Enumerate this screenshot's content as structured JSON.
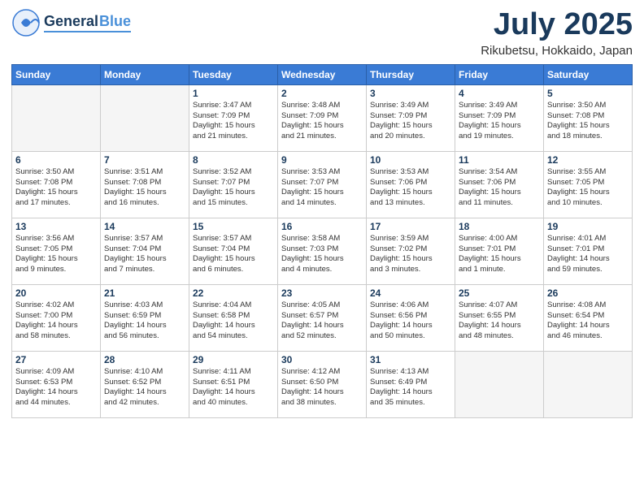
{
  "header": {
    "logo_line1": "General",
    "logo_line2": "Blue",
    "month": "July 2025",
    "location": "Rikubetsu, Hokkaido, Japan"
  },
  "weekdays": [
    "Sunday",
    "Monday",
    "Tuesday",
    "Wednesday",
    "Thursday",
    "Friday",
    "Saturday"
  ],
  "weeks": [
    [
      {
        "day": "",
        "info": ""
      },
      {
        "day": "",
        "info": ""
      },
      {
        "day": "1",
        "info": "Sunrise: 3:47 AM\nSunset: 7:09 PM\nDaylight: 15 hours\nand 21 minutes."
      },
      {
        "day": "2",
        "info": "Sunrise: 3:48 AM\nSunset: 7:09 PM\nDaylight: 15 hours\nand 21 minutes."
      },
      {
        "day": "3",
        "info": "Sunrise: 3:49 AM\nSunset: 7:09 PM\nDaylight: 15 hours\nand 20 minutes."
      },
      {
        "day": "4",
        "info": "Sunrise: 3:49 AM\nSunset: 7:09 PM\nDaylight: 15 hours\nand 19 minutes."
      },
      {
        "day": "5",
        "info": "Sunrise: 3:50 AM\nSunset: 7:08 PM\nDaylight: 15 hours\nand 18 minutes."
      }
    ],
    [
      {
        "day": "6",
        "info": "Sunrise: 3:50 AM\nSunset: 7:08 PM\nDaylight: 15 hours\nand 17 minutes."
      },
      {
        "day": "7",
        "info": "Sunrise: 3:51 AM\nSunset: 7:08 PM\nDaylight: 15 hours\nand 16 minutes."
      },
      {
        "day": "8",
        "info": "Sunrise: 3:52 AM\nSunset: 7:07 PM\nDaylight: 15 hours\nand 15 minutes."
      },
      {
        "day": "9",
        "info": "Sunrise: 3:53 AM\nSunset: 7:07 PM\nDaylight: 15 hours\nand 14 minutes."
      },
      {
        "day": "10",
        "info": "Sunrise: 3:53 AM\nSunset: 7:06 PM\nDaylight: 15 hours\nand 13 minutes."
      },
      {
        "day": "11",
        "info": "Sunrise: 3:54 AM\nSunset: 7:06 PM\nDaylight: 15 hours\nand 11 minutes."
      },
      {
        "day": "12",
        "info": "Sunrise: 3:55 AM\nSunset: 7:05 PM\nDaylight: 15 hours\nand 10 minutes."
      }
    ],
    [
      {
        "day": "13",
        "info": "Sunrise: 3:56 AM\nSunset: 7:05 PM\nDaylight: 15 hours\nand 9 minutes."
      },
      {
        "day": "14",
        "info": "Sunrise: 3:57 AM\nSunset: 7:04 PM\nDaylight: 15 hours\nand 7 minutes."
      },
      {
        "day": "15",
        "info": "Sunrise: 3:57 AM\nSunset: 7:04 PM\nDaylight: 15 hours\nand 6 minutes."
      },
      {
        "day": "16",
        "info": "Sunrise: 3:58 AM\nSunset: 7:03 PM\nDaylight: 15 hours\nand 4 minutes."
      },
      {
        "day": "17",
        "info": "Sunrise: 3:59 AM\nSunset: 7:02 PM\nDaylight: 15 hours\nand 3 minutes."
      },
      {
        "day": "18",
        "info": "Sunrise: 4:00 AM\nSunset: 7:01 PM\nDaylight: 15 hours\nand 1 minute."
      },
      {
        "day": "19",
        "info": "Sunrise: 4:01 AM\nSunset: 7:01 PM\nDaylight: 14 hours\nand 59 minutes."
      }
    ],
    [
      {
        "day": "20",
        "info": "Sunrise: 4:02 AM\nSunset: 7:00 PM\nDaylight: 14 hours\nand 58 minutes."
      },
      {
        "day": "21",
        "info": "Sunrise: 4:03 AM\nSunset: 6:59 PM\nDaylight: 14 hours\nand 56 minutes."
      },
      {
        "day": "22",
        "info": "Sunrise: 4:04 AM\nSunset: 6:58 PM\nDaylight: 14 hours\nand 54 minutes."
      },
      {
        "day": "23",
        "info": "Sunrise: 4:05 AM\nSunset: 6:57 PM\nDaylight: 14 hours\nand 52 minutes."
      },
      {
        "day": "24",
        "info": "Sunrise: 4:06 AM\nSunset: 6:56 PM\nDaylight: 14 hours\nand 50 minutes."
      },
      {
        "day": "25",
        "info": "Sunrise: 4:07 AM\nSunset: 6:55 PM\nDaylight: 14 hours\nand 48 minutes."
      },
      {
        "day": "26",
        "info": "Sunrise: 4:08 AM\nSunset: 6:54 PM\nDaylight: 14 hours\nand 46 minutes."
      }
    ],
    [
      {
        "day": "27",
        "info": "Sunrise: 4:09 AM\nSunset: 6:53 PM\nDaylight: 14 hours\nand 44 minutes."
      },
      {
        "day": "28",
        "info": "Sunrise: 4:10 AM\nSunset: 6:52 PM\nDaylight: 14 hours\nand 42 minutes."
      },
      {
        "day": "29",
        "info": "Sunrise: 4:11 AM\nSunset: 6:51 PM\nDaylight: 14 hours\nand 40 minutes."
      },
      {
        "day": "30",
        "info": "Sunrise: 4:12 AM\nSunset: 6:50 PM\nDaylight: 14 hours\nand 38 minutes."
      },
      {
        "day": "31",
        "info": "Sunrise: 4:13 AM\nSunset: 6:49 PM\nDaylight: 14 hours\nand 35 minutes."
      },
      {
        "day": "",
        "info": ""
      },
      {
        "day": "",
        "info": ""
      }
    ]
  ]
}
